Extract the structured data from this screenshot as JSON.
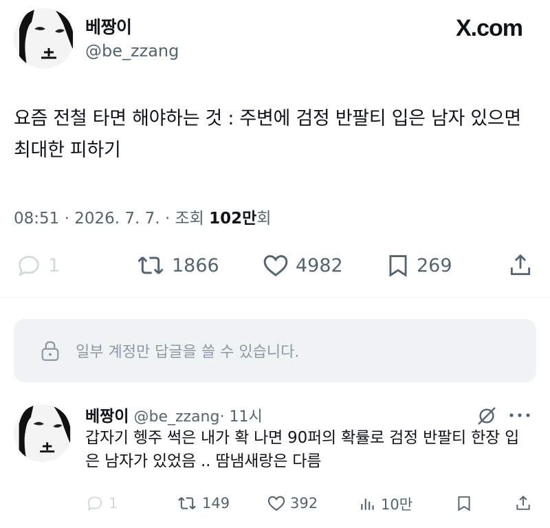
{
  "tweet": {
    "author_name": "베짱이",
    "author_handle": "@be_zzang",
    "brand_logo": "X.com",
    "text": "요즘 전철 타면 해야하는 것 : 주변에 검정 반팔티 입은 남자 있으면 최대한 피하기",
    "meta_prefix": "08:51 · 2026. 7. 7. · 조회 ",
    "meta_views": "102만",
    "meta_suffix": "회",
    "actions": {
      "replies": "1",
      "retweets": "1866",
      "likes": "4982",
      "bookmarks": "269"
    }
  },
  "reply_restriction": {
    "text": "일부 계정만 답글을 쓸 수 있습니다.",
    "icon": "lock-icon"
  },
  "reply": {
    "author_name": "베짱이",
    "author_handle": "@be_zzang",
    "time": "· 11시",
    "text": "갑자기 헹주 썩은 내가 확 나면 90퍼의 확률로 검정 반팔티 한장 입은 남자가 있었음 .. 땀냄새랑은 다름",
    "actions": {
      "replies": "1",
      "retweets": "149",
      "likes": "392",
      "views": "10만"
    }
  },
  "colors": {
    "text": "#0f1419",
    "secondary": "#536471",
    "panel": "#eff3f4",
    "restriction_text": "#8b98a5"
  }
}
